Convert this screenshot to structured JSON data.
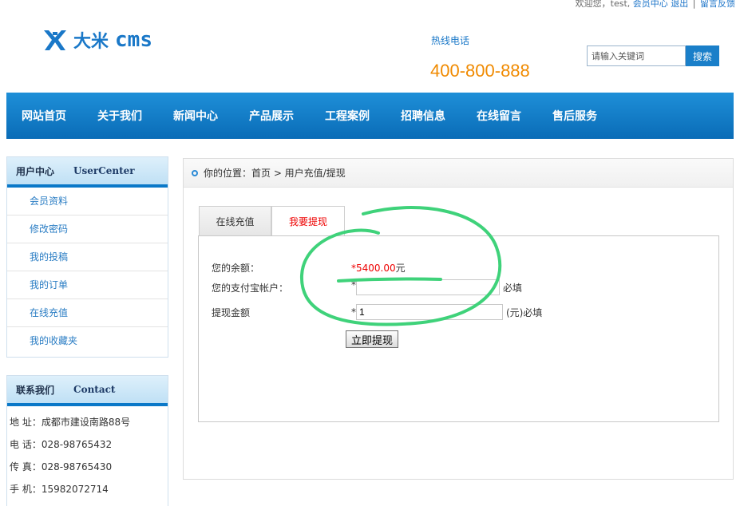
{
  "topbar": {
    "welcome": "欢迎您，test,",
    "user_center": "会员中心",
    "logout": "退出",
    "feedback": "留言反馈",
    "separator": "|"
  },
  "brand": {
    "logo_cn": "大米",
    "logo_en": "cms",
    "accent": "#1a78c8"
  },
  "hotline": {
    "label": "热线电话",
    "number": "400-800-888",
    "color": "#f08a00"
  },
  "search": {
    "placeholder": "请输入关键词",
    "button": "搜索"
  },
  "nav": {
    "items": [
      "网站首页",
      "关于我们",
      "新闻中心",
      "产品展示",
      "工程案例",
      "招聘信息",
      "在线留言",
      "售后服务"
    ]
  },
  "sidebar": {
    "user_center": {
      "title_cn": "用户中心",
      "title_en": "UserCenter",
      "items": [
        "会员资料",
        "修改密码",
        "我的投稿",
        "我的订单",
        "在线充值",
        "我的收藏夹"
      ]
    },
    "contact": {
      "title_cn": "联系我们",
      "title_en": "Contact",
      "lines": [
        "地 址：成都市建设南路88号",
        "电 话：028-98765432",
        "传 真：028-98765430",
        "手 机：15982072714"
      ]
    }
  },
  "breadcrumb": {
    "text": "你的位置：首页 > 用户充值/提现"
  },
  "tabs": [
    {
      "label": "在线充值",
      "active": false
    },
    {
      "label": "我要提现",
      "active": true
    }
  ],
  "form": {
    "balance_label": "您的余额：",
    "balance_star": "*",
    "balance_value": "5400.00",
    "balance_unit": "元",
    "alipay_label": "您的支付宝帐户：",
    "alipay_star": "*",
    "alipay_value": "",
    "alipay_note": "必填",
    "amount_label": "提现金额",
    "amount_star": "*",
    "amount_value": "1",
    "amount_note": "(元)必填",
    "submit": "立即提现"
  },
  "colors": {
    "nav_bg": "#0a6cb7",
    "highlight_red": "#e00000",
    "annotation_green": "#3fd27a"
  }
}
